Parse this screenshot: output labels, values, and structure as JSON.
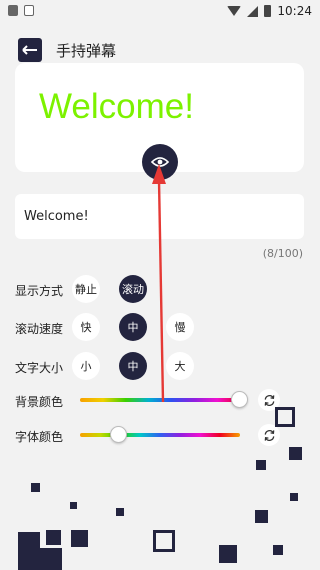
{
  "status_bar": {
    "time": "10:24"
  },
  "header": {
    "title": "手持弹幕"
  },
  "preview": {
    "text": "Welcome!",
    "text_color": "#7cf200"
  },
  "input": {
    "value": "Welcome!",
    "counter": "(8/100)"
  },
  "display_mode": {
    "label": "显示方式",
    "options": [
      "静止",
      "滚动"
    ],
    "selected": "滚动"
  },
  "scroll_speed": {
    "label": "滚动速度",
    "options": [
      "快",
      "中",
      "慢"
    ],
    "selected": "中"
  },
  "text_size": {
    "label": "文字大小",
    "options": [
      "小",
      "中",
      "大"
    ],
    "selected": "中"
  },
  "bg_color": {
    "label": "背景颜色",
    "slider_value": 1.0
  },
  "font_color": {
    "label": "字体颜色",
    "slider_value": 0.25
  },
  "colors": {
    "accent": "#23243f",
    "background": "#f2f2f2",
    "annotation_arrow": "#e53935"
  }
}
